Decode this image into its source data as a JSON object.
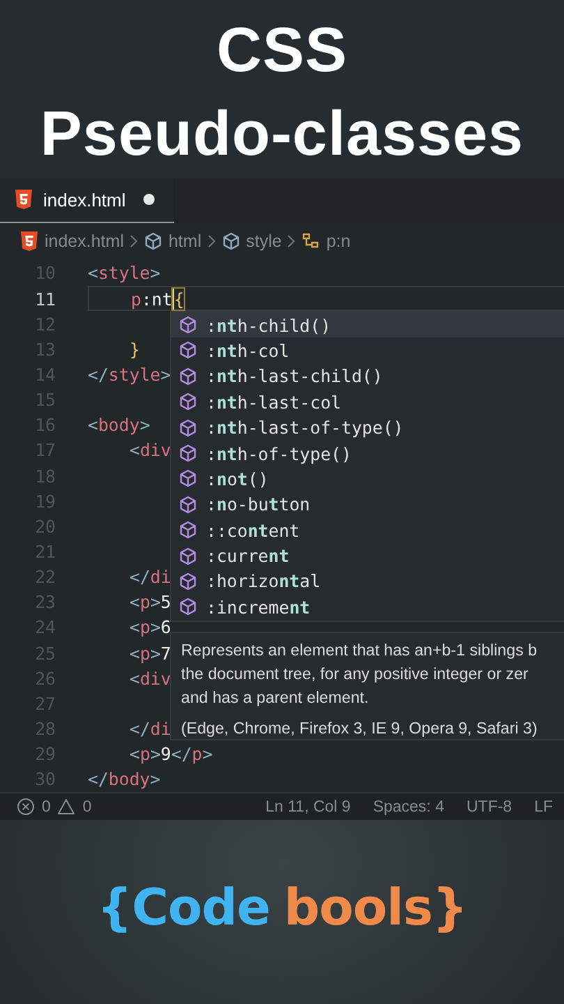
{
  "title": {
    "lines": [
      "CSS",
      "Pseudo-classes"
    ]
  },
  "editor": {
    "tabs": [
      {
        "label": "index.html",
        "selected": true,
        "modified": true
      }
    ],
    "breadcrumbs": [
      {
        "label": "index.html",
        "kind": "file"
      },
      {
        "label": "html",
        "kind": "element"
      },
      {
        "label": "style",
        "kind": "element"
      },
      {
        "label": "p:n",
        "kind": "selector"
      }
    ],
    "lines": [
      {
        "number": "10",
        "current": false,
        "kind": "top",
        "tokens": [
          {
            "text": "<",
            "kind": "punct"
          },
          {
            "text": "style",
            "kind": "tag"
          },
          {
            "text": ">",
            "kind": "punct"
          }
        ]
      },
      {
        "number": "11",
        "current": true,
        "kind": "nested",
        "tokens": [
          {
            "text": "p",
            "kind": "tag"
          },
          {
            "text": ":nt",
            "kind": "text"
          },
          {
            "text": "{",
            "kind": "matched-brace"
          }
        ]
      },
      {
        "number": "12",
        "current": false,
        "kind": "blank"
      },
      {
        "number": "13",
        "current": false,
        "kind": "nested",
        "tokens": [
          {
            "text": "}",
            "kind": "brace"
          }
        ]
      },
      {
        "number": "14",
        "current": false,
        "kind": "top",
        "tokens": [
          {
            "text": "</",
            "kind": "punct"
          },
          {
            "text": "style",
            "kind": "tag"
          },
          {
            "text": ">",
            "kind": "punct"
          }
        ]
      },
      {
        "number": "15",
        "current": false,
        "kind": "blank"
      },
      {
        "number": "16",
        "current": false,
        "kind": "top",
        "tokens": [
          {
            "text": "<",
            "kind": "punct"
          },
          {
            "text": "body",
            "kind": "tag"
          },
          {
            "text": ">",
            "kind": "punct"
          }
        ]
      },
      {
        "number": "17",
        "current": false,
        "kind": "nested",
        "tokens": [
          {
            "text": "<",
            "kind": "punct"
          },
          {
            "text": "div",
            "kind": "tag"
          }
        ]
      },
      {
        "number": "18",
        "current": false,
        "kind": "blank"
      },
      {
        "number": "19",
        "current": false,
        "kind": "blank"
      },
      {
        "number": "20",
        "current": false,
        "kind": "blank"
      },
      {
        "number": "21",
        "current": false,
        "kind": "blank"
      },
      {
        "number": "22",
        "current": false,
        "kind": "nested",
        "tokens": [
          {
            "text": "</",
            "kind": "punct"
          },
          {
            "text": "di",
            "kind": "tag"
          }
        ]
      },
      {
        "number": "23",
        "current": false,
        "kind": "nested",
        "tokens": [
          {
            "text": "<",
            "kind": "punct"
          },
          {
            "text": "p",
            "kind": "tag"
          },
          {
            "text": ">",
            "kind": "punct"
          },
          {
            "text": "5",
            "kind": "text"
          }
        ]
      },
      {
        "number": "24",
        "current": false,
        "kind": "nested",
        "tokens": [
          {
            "text": "<",
            "kind": "punct"
          },
          {
            "text": "p",
            "kind": "tag"
          },
          {
            "text": ">",
            "kind": "punct"
          },
          {
            "text": "6",
            "kind": "text"
          }
        ]
      },
      {
        "number": "25",
        "current": false,
        "kind": "nested",
        "tokens": [
          {
            "text": "<",
            "kind": "punct"
          },
          {
            "text": "p",
            "kind": "tag"
          },
          {
            "text": ">",
            "kind": "punct"
          },
          {
            "text": "7",
            "kind": "text"
          }
        ]
      },
      {
        "number": "26",
        "current": false,
        "kind": "nested",
        "tokens": [
          {
            "text": "<",
            "kind": "punct"
          },
          {
            "text": "div",
            "kind": "tag"
          }
        ]
      },
      {
        "number": "27",
        "current": false,
        "kind": "blank"
      },
      {
        "number": "28",
        "current": false,
        "kind": "nested",
        "tokens": [
          {
            "text": "</",
            "kind": "punct"
          },
          {
            "text": "di",
            "kind": "tag"
          }
        ]
      },
      {
        "number": "29",
        "current": false,
        "kind": "nested",
        "tokens": [
          {
            "text": "<",
            "kind": "punct"
          },
          {
            "text": "p",
            "kind": "tag"
          },
          {
            "text": ">",
            "kind": "punct"
          },
          {
            "text": "9",
            "kind": "text"
          },
          {
            "text": "</",
            "kind": "punct"
          },
          {
            "text": "p",
            "kind": "tag"
          },
          {
            "text": ">",
            "kind": "punct"
          }
        ]
      },
      {
        "number": "30",
        "current": false,
        "kind": "top",
        "tokens": [
          {
            "text": "</",
            "kind": "punct"
          },
          {
            "text": "body",
            "kind": "tag"
          },
          {
            "text": ">",
            "kind": "punct"
          }
        ]
      }
    ],
    "suggestions": [
      {
        "label": ":**nt**h-child()",
        "selected": true
      },
      {
        "label": ":**nt**h-col",
        "selected": false
      },
      {
        "label": ":**nt**h-last-child()",
        "selected": false
      },
      {
        "label": ":**nt**h-last-col",
        "selected": false
      },
      {
        "label": ":**nt**h-last-of-type()",
        "selected": false
      },
      {
        "label": ":**nt**h-of-type()",
        "selected": false
      },
      {
        "label": ":**n**o**t**()",
        "selected": false
      },
      {
        "label": ":**n**o-bu**t**ton",
        "selected": false
      },
      {
        "label": "::co**nt**ent",
        "selected": false
      },
      {
        "label": ":curre**nt**",
        "selected": false
      },
      {
        "label": ":horizo**nt**al",
        "selected": false
      },
      {
        "label": ":increme**nt**",
        "selected": false
      }
    ],
    "details": {
      "description_lines": [
        "Represents an element that has an+b-1 siblings b",
        "the document tree, for any positive integer or zer",
        "and has a parent element."
      ],
      "support": "(Edge, Chrome, Firefox 3, IE 9, Opera 9, Safari 3)"
    },
    "status_bar": {
      "errors": "0",
      "warnings": "0",
      "position": "Ln 11, Col 9",
      "indentation": "Spaces: 4",
      "encoding": "UTF-8",
      "line_ending": "LF"
    }
  },
  "brand": {
    "parts": [
      {
        "text": "{Code",
        "color": "#3fb4f0"
      },
      {
        "text": "bools}",
        "color": "#f08a4b"
      }
    ]
  }
}
